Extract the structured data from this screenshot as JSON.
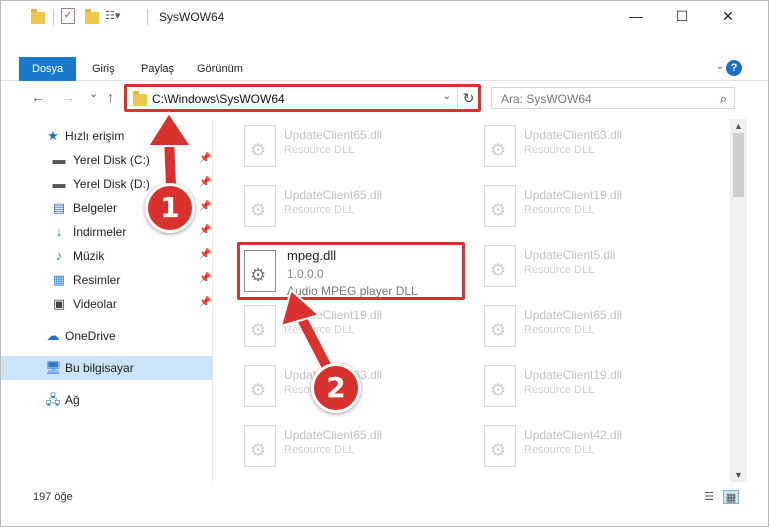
{
  "window": {
    "title": "SysWOW64",
    "minimize": "—",
    "maximize": "☐",
    "close": "✕"
  },
  "ribbon": {
    "tabs": [
      "Dosya",
      "Giriş",
      "Paylaş",
      "Görünüm"
    ],
    "help": "?"
  },
  "nav": {
    "back": "←",
    "forward": "→",
    "recent": "⌄",
    "up": "↑",
    "address": "C:\\Windows\\SysWOW64",
    "search_placeholder": "Ara: SysWOW64"
  },
  "sidebar": {
    "items": [
      {
        "label": "Hızlı erişim",
        "icon": "star-icon",
        "pinned": false
      },
      {
        "label": "Yerel Disk (C:)",
        "icon": "drive-icon",
        "pinned": true
      },
      {
        "label": "Yerel Disk (D:)",
        "icon": "drive-icon",
        "pinned": true
      },
      {
        "label": "Belgeler",
        "icon": "documents-icon",
        "pinned": true
      },
      {
        "label": "İndirmeler",
        "icon": "download-icon",
        "pinned": true
      },
      {
        "label": "Müzik",
        "icon": "music-icon",
        "pinned": true
      },
      {
        "label": "Resimler",
        "icon": "pictures-icon",
        "pinned": true
      },
      {
        "label": "Videolar",
        "icon": "video-icon",
        "pinned": true
      },
      {
        "label": "OneDrive",
        "icon": "cloud-icon",
        "pinned": false
      },
      {
        "label": "Bu bilgisayar",
        "icon": "computer-icon",
        "pinned": false,
        "selected": true
      },
      {
        "label": "Ağ",
        "icon": "network-icon",
        "pinned": false
      }
    ]
  },
  "files": {
    "faded": [
      {
        "name": "UpdateClient65.dll",
        "desc": "Resource DLL"
      },
      {
        "name": "UpdateClient63.dll",
        "desc": "Resource DLL"
      },
      {
        "name": "UpdateClient65.dll",
        "desc": "Resource DLL"
      },
      {
        "name": "UpdateClient19.dll",
        "desc": "Resource DLL"
      },
      {
        "name": "UpdateClient5.dll",
        "desc": "Resource DLL"
      },
      {
        "name": "UpdateClient19.dll",
        "desc": "Resource DLL"
      },
      {
        "name": "UpdateClient65.dll",
        "desc": "Resource DLL"
      },
      {
        "name": "UpdateClient63.dll",
        "desc": "Resource DLL"
      },
      {
        "name": "UpdateClient19.dll",
        "desc": "Resource DLL"
      },
      {
        "name": "UpdateClient65.dll",
        "desc": "Resource DLL"
      },
      {
        "name": "UpdateClient42.dll",
        "desc": "Resource DLL"
      }
    ],
    "highlighted": {
      "name": "mpeg.dll",
      "version": "1.0.0.0",
      "desc": "Audio MPEG player DLL"
    }
  },
  "status": {
    "item_count": "197 öğe"
  },
  "callouts": {
    "one": "1",
    "two": "2",
    "color": "#d9322e"
  }
}
